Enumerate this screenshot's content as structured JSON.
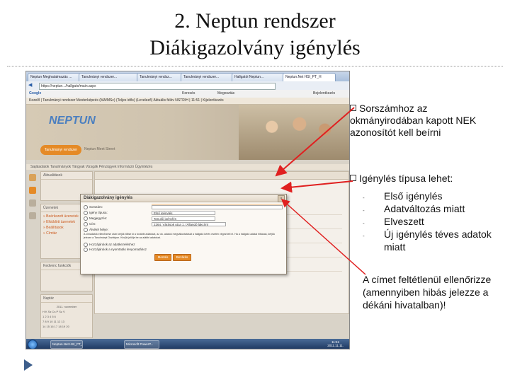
{
  "slide": {
    "title_line1": "2. Neptun rendszer",
    "title_line2": "Diákigazolvány igénylés"
  },
  "browser": {
    "tabs": [
      "Neptun Meghatalmazás ...",
      "Tanulmányi rendszer...",
      "Tanulmányi rendsz...",
      "Tanulmányi rendszer...",
      "Hallgatói Neptun...",
      "Neptun.Net HSI_PT_H"
    ],
    "address": "https://neptun.../hallgato/main.aspx",
    "google_bar": "Google",
    "tb_buttons": [
      "Keresés",
      "Megosztás",
      "Bejelentkezés"
    ]
  },
  "neptun": {
    "top_menu": "Kezelő | Tanulmányi rendszer  Mesterképzés (MA/MSc) (Teljes idős) (Levelező)          Aktuális félév  NSTR/H  |  11:51  |  Kijelentkezés",
    "logo": "NEPTUN",
    "orange_tab": "Tanulmányi rendszer",
    "gray_tab": "Neptun Meet Street",
    "submenu": "Sajátadatok    Tanulmányok    Tárgyak    Vizsgák    Pénzügyek    Információ    Ügyintézés",
    "left_panels": {
      "aktualitasok": "Aktualitások",
      "uzenetek": "Üzenetek",
      "uzenetek_links": [
        "» Beérkezett üzenetek",
        "» Elküldött üzenetek",
        "» Beállítások",
        "» Címtár"
      ],
      "kedvenc": "Kedvenc funkciók",
      "naptar": "Naptár",
      "naptar_month": "2011. november",
      "naptar_rows": [
        "H  K  Sz  Cs  P  Sz  V",
        "   1   2   3   4   5   6",
        "7   8   9  10  11  12  13",
        "14  15  16  17  18  19  20"
      ]
    }
  },
  "dialog": {
    "title": "Diákigazolvány igénylés",
    "rows": [
      {
        "label": "Sorszám:",
        "value": ""
      },
      {
        "label": "Igény típusa:",
        "value": "Első igénylés"
      },
      {
        "label": "Megjegyzés:",
        "value": "Tanulói igénylés"
      },
      {
        "label": "Cím:",
        "value": "2264. Várások utca 1. (Állandó lakcím)"
      },
      {
        "label": "Átvétel helye:",
        "value": ""
      }
    ],
    "notice": "A címadatok ellenőrzése után kérjük töltse ki a további adatokat, az ok. adatok megváltoztatását a hallgató kérés esetén végezheti el. Ha a hallgató adatai hibásak, kérjük jelezze a Tanulmányi Osztályon. Kérjük jelölje be az alábbi adatokat.",
    "checkbox1": "Hozzájárulok az adatkezeléshez",
    "checkbox2": "Hozzájárulok a nyomtatás lenyomatához",
    "btn_save": "Mentés",
    "btn_cancel": "Bezárás"
  },
  "taskbar": {
    "items": [
      "Neptun.Net HSI_PT_H",
      "Microsoft PowerP..."
    ],
    "clock_time": "11:51",
    "clock_date": "2011.11.11."
  },
  "notes": {
    "bullet1": "Sorszámhoz az okmányirodában kapott NEK azonosítót kell beírni",
    "bullet2": "Igénylés típusa lehet:",
    "types": [
      "Első igénylés",
      "Adatváltozás miatt",
      "Elveszett",
      "Új igénylés téves adatok miatt"
    ],
    "remark": "A címet feltétlenül ellenőrizze (amennyiben hibás jelezze a dékáni hivatalban)!"
  },
  "colors": {
    "accent_orange": "#e58a26",
    "arrow_red": "#e02020",
    "neptun_blue": "#4b7fc0"
  }
}
